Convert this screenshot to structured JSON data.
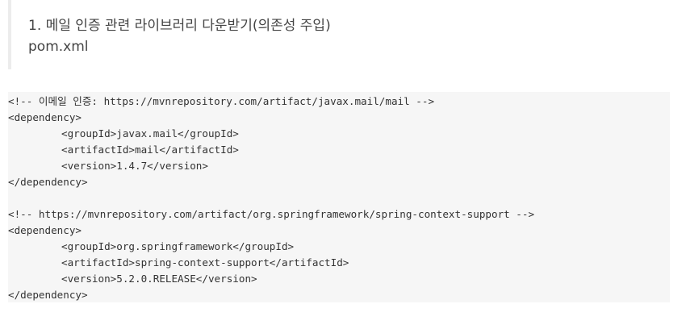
{
  "quote": {
    "line1": "1. 메일 인증 관련 라이브러리 다운받기(의존성 주입)",
    "line2": "pom.xml"
  },
  "code": {
    "block1": {
      "comment": "<!-- 이메일 인증: https://mvnrepository.com/artifact/javax.mail/mail -->",
      "open": "<dependency>",
      "group": "<groupId>javax.mail</groupId>",
      "artifact": "<artifactId>mail</artifactId>",
      "version": "<version>1.4.7</version>",
      "close": "</dependency>"
    },
    "block2": {
      "comment": "<!-- https://mvnrepository.com/artifact/org.springframework/spring-context-support -->",
      "open": "<dependency>",
      "group": "<groupId>org.springframework</groupId>",
      "artifact": "<artifactId>spring-context-support</artifactId>",
      "version": "<version>5.2.0.RELEASE</version>",
      "close": "</dependency>"
    }
  }
}
